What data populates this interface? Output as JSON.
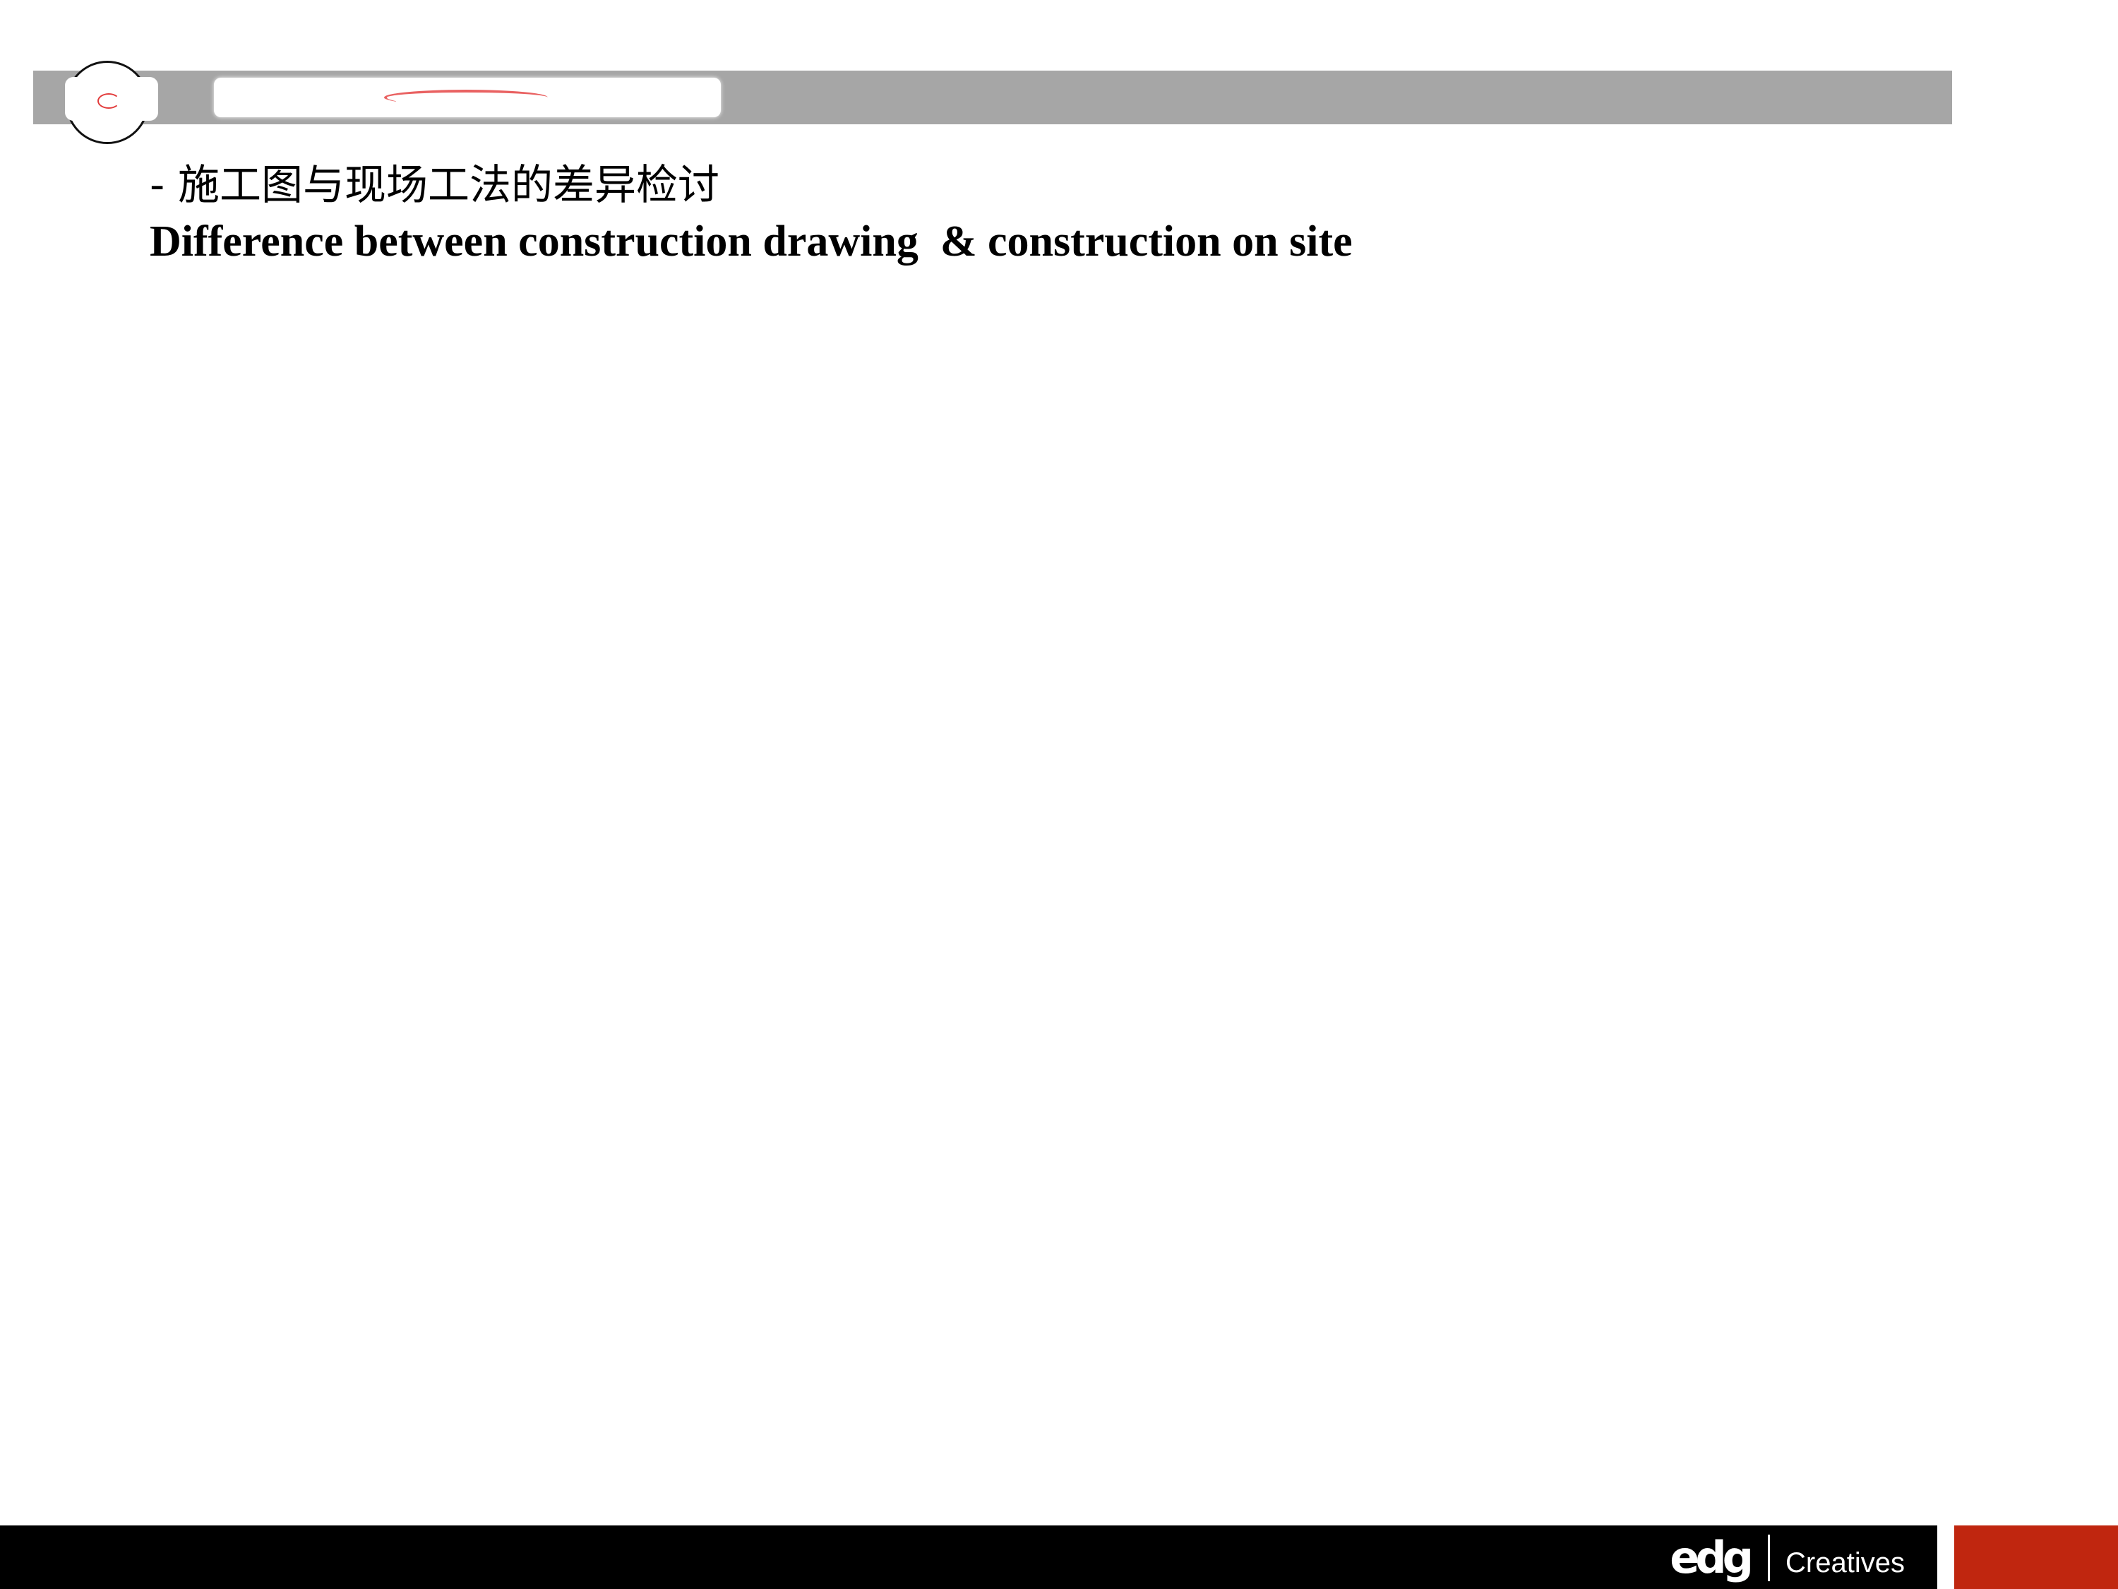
{
  "slide": {
    "heading_cn": "- 施工图与现场工法的差异检讨",
    "heading_en": "Difference between construction drawing  & construction on site"
  },
  "footer": {
    "logo_mark": "edg",
    "logo_text": "Creatives",
    "accent_color": "#c0260f",
    "bar_color": "#000000"
  },
  "header": {
    "bar_color": "#a6a6a6"
  }
}
